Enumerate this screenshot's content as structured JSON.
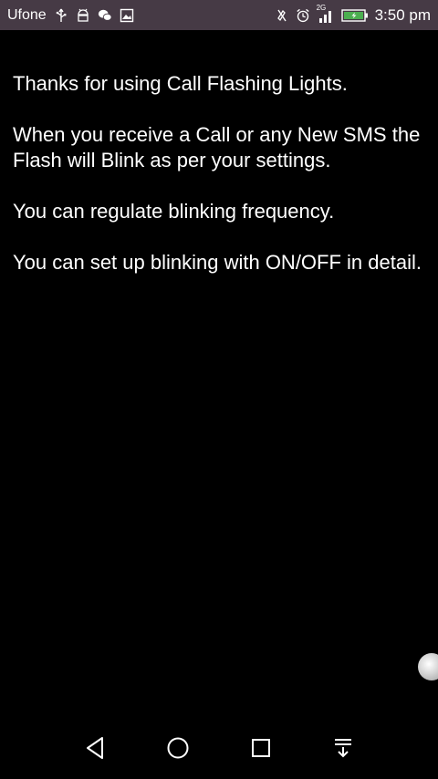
{
  "status_bar": {
    "carrier": "Ufone",
    "network_type": "2G",
    "time": "3:50 pm",
    "left_icons": [
      "usb-icon",
      "android-debug-icon",
      "wechat-icon",
      "image-icon"
    ],
    "right_icons": [
      "vibrate-icon",
      "alarm-icon",
      "signal-icon",
      "battery-icon"
    ]
  },
  "content": {
    "paragraphs": [
      "Thanks for using Call Flashing Lights.",
      "When you receive a Call or any New SMS the Flash will Blink as per your settings.",
      "You can regulate blinking frequency.",
      "You can set up blinking with ON/OFF in detail."
    ]
  },
  "nav_bar": {
    "buttons": [
      "back-icon",
      "home-icon",
      "recents-icon",
      "notification-pull-icon"
    ]
  },
  "colors": {
    "status_bar_bg": "#463a45",
    "background": "#000000",
    "text": "#ffffff",
    "battery_fill": "#4caf50"
  }
}
